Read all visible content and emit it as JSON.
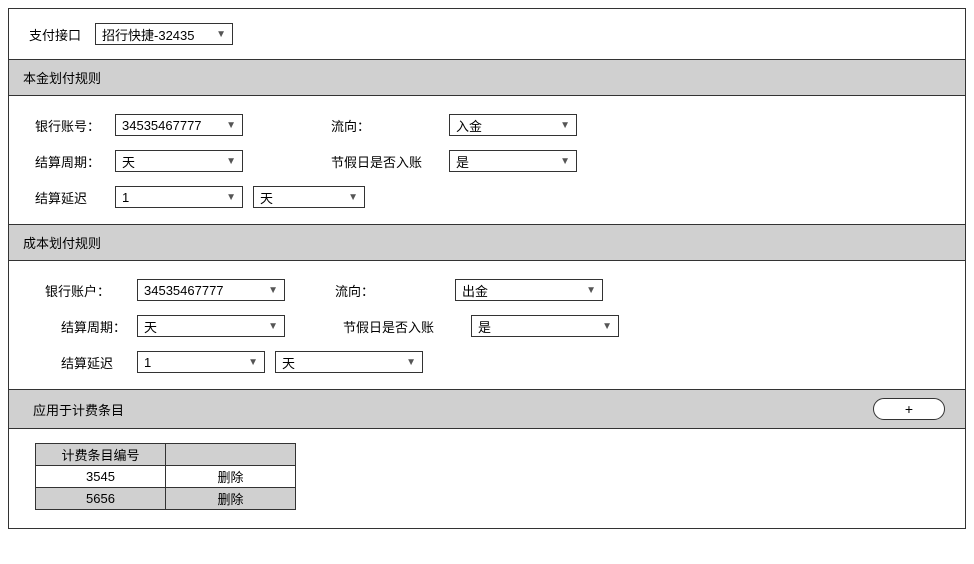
{
  "top": {
    "label": "支付接口",
    "value": "招行快捷-32435"
  },
  "principal": {
    "header": "本金划付规则",
    "bank_label": "银行账号：",
    "bank_value": "34535467777",
    "flow_label": "流向：",
    "flow_value": "入金",
    "cycle_label": "结算周期：",
    "cycle_value": "天",
    "holiday_label": "节假日是否入账",
    "holiday_value": "是",
    "delay_label": "结算延迟",
    "delay_num": "1",
    "delay_unit": "天"
  },
  "cost": {
    "header": "成本划付规则",
    "bank_label": "银行账户：",
    "bank_value": "34535467777",
    "flow_label": "流向：",
    "flow_value": "出金",
    "cycle_label": "结算周期：",
    "cycle_value": "天",
    "holiday_label": "节假日是否入账",
    "holiday_value": "是",
    "delay_label": "结算延迟",
    "delay_num": "1",
    "delay_unit": "天"
  },
  "billing": {
    "header": "应用于计费条目",
    "plus": "+",
    "col1": "计费条目编号",
    "col2": "",
    "rows": [
      {
        "id": "3545",
        "action": "删除"
      },
      {
        "id": "5656",
        "action": "删除"
      }
    ]
  }
}
